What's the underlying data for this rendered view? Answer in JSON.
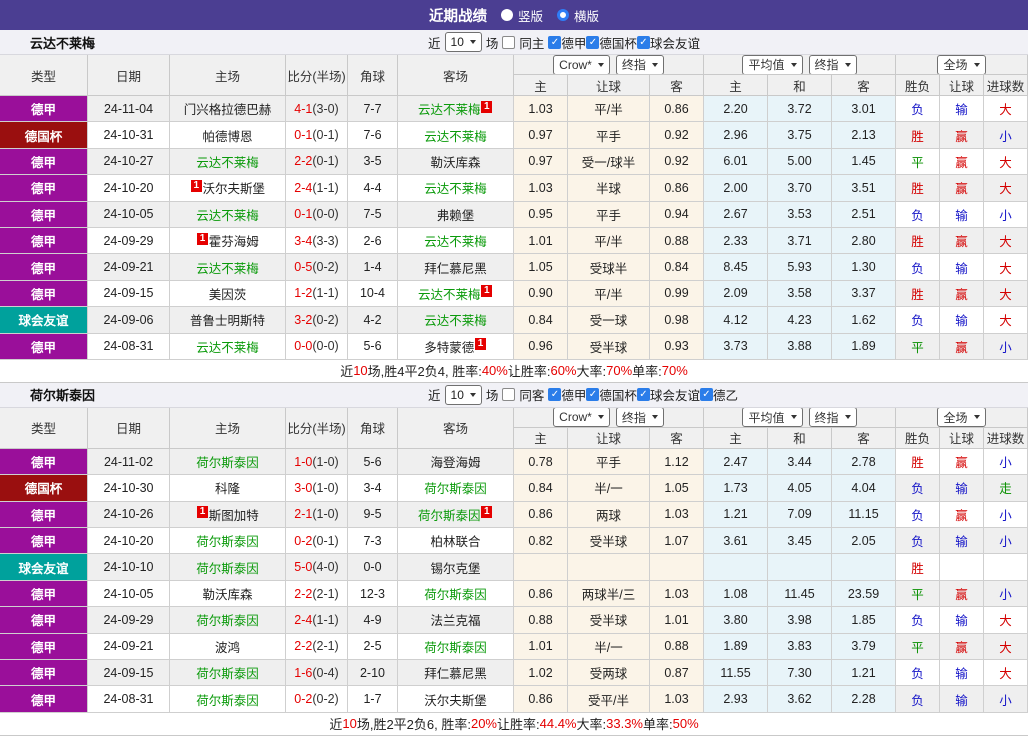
{
  "topbar": {
    "title": "近期战绩",
    "radio_vertical": {
      "label": "竖版",
      "checked": false
    },
    "radio_horizontal": {
      "label": "横版",
      "checked": true
    }
  },
  "colors": {
    "topbar_bg": "#4b3e92",
    "league": {
      "德甲": "#9a0f9a",
      "德国杯": "#9a0f0f",
      "球会友谊": "#00a19c",
      "德乙": "#9a0f9a"
    },
    "result_map": {
      "胜": "#d40000",
      "负": "#1515c8",
      "平": "#089000",
      "赢": "#d40000",
      "输": "#1515c8",
      "走": "#089000",
      "大": "#d40000",
      "小": "#1515c8"
    },
    "score": "#e50000",
    "half": "#333333",
    "team_green": "#0a9a0a",
    "row_stripe": "#efefef",
    "odds_bg": "#fbf4e8",
    "avg_bg": "#e8f4f9"
  },
  "sections": [
    {
      "team": "云达不莱梅",
      "filters": {
        "recent_label": "近",
        "match_count": "10",
        "games_label": "场",
        "same_label": "同主",
        "same_checked": false,
        "leagues": [
          "德甲",
          "德国杯",
          "球会友谊"
        ]
      },
      "selects": {
        "odds_source": "Crow*",
        "odds_time": "终指",
        "avg_label": "平均值",
        "avg_time": "终指",
        "scope": "全场"
      },
      "columns": {
        "left": [
          "类型",
          "日期",
          "主场",
          "比分(半场)",
          "角球",
          "客场"
        ],
        "odds": [
          "主",
          "让球",
          "客"
        ],
        "avg": [
          "主",
          "和",
          "客"
        ],
        "result": [
          "胜负",
          "让球",
          "进球数"
        ]
      },
      "rows": [
        {
          "type": "德甲",
          "date": "24-11-04",
          "home": "门兴格拉德巴赫",
          "hb": "",
          "score": "4-1",
          "half": "(3-0)",
          "corner": "7-7",
          "away": "云达不莱梅",
          "ab": "1",
          "odds": [
            "1.03",
            "平/半",
            "0.86"
          ],
          "avg": [
            "2.20",
            "3.72",
            "3.01"
          ],
          "res": [
            "负",
            "输",
            "大"
          ]
        },
        {
          "type": "德国杯",
          "date": "24-10-31",
          "home": "帕德博恩",
          "hb": "",
          "score": "0-1",
          "half": "(0-1)",
          "corner": "7-6",
          "away": "云达不莱梅",
          "ab": "",
          "odds": [
            "0.97",
            "平手",
            "0.92"
          ],
          "avg": [
            "2.96",
            "3.75",
            "2.13"
          ],
          "res": [
            "胜",
            "赢",
            "小"
          ]
        },
        {
          "type": "德甲",
          "date": "24-10-27",
          "home": "云达不莱梅",
          "hb": "",
          "score": "2-2",
          "half": "(0-1)",
          "corner": "3-5",
          "away": "勒沃库森",
          "ab": "",
          "odds": [
            "0.97",
            "受一/球半",
            "0.92"
          ],
          "avg": [
            "6.01",
            "5.00",
            "1.45"
          ],
          "res": [
            "平",
            "赢",
            "大"
          ]
        },
        {
          "type": "德甲",
          "date": "24-10-20",
          "home": "沃尔夫斯堡",
          "hb": "1",
          "score": "2-4",
          "half": "(1-1)",
          "corner": "4-4",
          "away": "云达不莱梅",
          "ab": "",
          "odds": [
            "1.03",
            "半球",
            "0.86"
          ],
          "avg": [
            "2.00",
            "3.70",
            "3.51"
          ],
          "res": [
            "胜",
            "赢",
            "大"
          ]
        },
        {
          "type": "德甲",
          "date": "24-10-05",
          "home": "云达不莱梅",
          "hb": "",
          "score": "0-1",
          "half": "(0-0)",
          "corner": "7-5",
          "away": "弗赖堡",
          "ab": "",
          "odds": [
            "0.95",
            "平手",
            "0.94"
          ],
          "avg": [
            "2.67",
            "3.53",
            "2.51"
          ],
          "res": [
            "负",
            "输",
            "小"
          ]
        },
        {
          "type": "德甲",
          "date": "24-09-29",
          "home": "霍芬海姆",
          "hb": "1",
          "score": "3-4",
          "half": "(3-3)",
          "corner": "2-6",
          "away": "云达不莱梅",
          "ab": "",
          "odds": [
            "1.01",
            "平/半",
            "0.88"
          ],
          "avg": [
            "2.33",
            "3.71",
            "2.80"
          ],
          "res": [
            "胜",
            "赢",
            "大"
          ]
        },
        {
          "type": "德甲",
          "date": "24-09-21",
          "home": "云达不莱梅",
          "hb": "",
          "score": "0-5",
          "half": "(0-2)",
          "corner": "1-4",
          "away": "拜仁慕尼黑",
          "ab": "",
          "odds": [
            "1.05",
            "受球半",
            "0.84"
          ],
          "avg": [
            "8.45",
            "5.93",
            "1.30"
          ],
          "res": [
            "负",
            "输",
            "大"
          ]
        },
        {
          "type": "德甲",
          "date": "24-09-15",
          "home": "美因茨",
          "hb": "",
          "score": "1-2",
          "half": "(1-1)",
          "corner": "10-4",
          "away": "云达不莱梅",
          "ab": "1",
          "odds": [
            "0.90",
            "平/半",
            "0.99"
          ],
          "avg": [
            "2.09",
            "3.58",
            "3.37"
          ],
          "res": [
            "胜",
            "赢",
            "大"
          ]
        },
        {
          "type": "球会友谊",
          "date": "24-09-06",
          "home": "普鲁士明斯特",
          "hb": "",
          "score": "3-2",
          "half": "(0-2)",
          "corner": "4-2",
          "away": "云达不莱梅",
          "ab": "",
          "odds": [
            "0.84",
            "受一球",
            "0.98"
          ],
          "avg": [
            "4.12",
            "4.23",
            "1.62"
          ],
          "res": [
            "负",
            "输",
            "大"
          ]
        },
        {
          "type": "德甲",
          "date": "24-08-31",
          "home": "云达不莱梅",
          "hb": "",
          "score": "0-0",
          "half": "(0-0)",
          "corner": "5-6",
          "away": "多特蒙德",
          "ab": "1",
          "odds": [
            "0.96",
            "受半球",
            "0.93"
          ],
          "avg": [
            "3.73",
            "3.88",
            "1.89"
          ],
          "res": [
            "平",
            "赢",
            "小"
          ]
        }
      ],
      "summary": [
        {
          "t": "近",
          "c": "k"
        },
        {
          "t": "10",
          "c": "r"
        },
        {
          "t": "场,胜4平2负4, 胜率:",
          "c": "k"
        },
        {
          "t": "40%",
          "c": "r"
        },
        {
          "t": " 让胜率:",
          "c": "k"
        },
        {
          "t": "60%",
          "c": "r"
        },
        {
          "t": " 大率:",
          "c": "k"
        },
        {
          "t": "70%",
          "c": "r"
        },
        {
          "t": " 单率:",
          "c": "k"
        },
        {
          "t": "70%",
          "c": "r"
        }
      ]
    },
    {
      "team": "荷尔斯泰因",
      "filters": {
        "recent_label": "近",
        "match_count": "10",
        "games_label": "场",
        "same_label": "同客",
        "same_checked": false,
        "leagues": [
          "德甲",
          "德国杯",
          "球会友谊",
          "德乙"
        ]
      },
      "selects": {
        "odds_source": "Crow*",
        "odds_time": "终指",
        "avg_label": "平均值",
        "avg_time": "终指",
        "scope": "全场"
      },
      "columns": {
        "left": [
          "类型",
          "日期",
          "主场",
          "比分(半场)",
          "角球",
          "客场"
        ],
        "odds": [
          "主",
          "让球",
          "客"
        ],
        "avg": [
          "主",
          "和",
          "客"
        ],
        "result": [
          "胜负",
          "让球",
          "进球数"
        ]
      },
      "rows": [
        {
          "type": "德甲",
          "date": "24-11-02",
          "home": "荷尔斯泰因",
          "hb": "",
          "score": "1-0",
          "half": "(1-0)",
          "corner": "5-6",
          "away": "海登海姆",
          "ab": "",
          "odds": [
            "0.78",
            "平手",
            "1.12"
          ],
          "avg": [
            "2.47",
            "3.44",
            "2.78"
          ],
          "res": [
            "胜",
            "赢",
            "小"
          ]
        },
        {
          "type": "德国杯",
          "date": "24-10-30",
          "home": "科隆",
          "hb": "",
          "score": "3-0",
          "half": "(1-0)",
          "corner": "3-4",
          "away": "荷尔斯泰因",
          "ab": "",
          "odds": [
            "0.84",
            "半/一",
            "1.05"
          ],
          "avg": [
            "1.73",
            "4.05",
            "4.04"
          ],
          "res": [
            "负",
            "输",
            "走"
          ]
        },
        {
          "type": "德甲",
          "date": "24-10-26",
          "home": "斯图加特",
          "hb": "1",
          "score": "2-1",
          "half": "(1-0)",
          "corner": "9-5",
          "away": "荷尔斯泰因",
          "ab": "1",
          "odds": [
            "0.86",
            "两球",
            "1.03"
          ],
          "avg": [
            "1.21",
            "7.09",
            "11.15"
          ],
          "res": [
            "负",
            "赢",
            "小"
          ]
        },
        {
          "type": "德甲",
          "date": "24-10-20",
          "home": "荷尔斯泰因",
          "hb": "",
          "score": "0-2",
          "half": "(0-1)",
          "corner": "7-3",
          "away": "柏林联合",
          "ab": "",
          "odds": [
            "0.82",
            "受半球",
            "1.07"
          ],
          "avg": [
            "3.61",
            "3.45",
            "2.05"
          ],
          "res": [
            "负",
            "输",
            "小"
          ]
        },
        {
          "type": "球会友谊",
          "date": "24-10-10",
          "home": "荷尔斯泰因",
          "hb": "",
          "score": "5-0",
          "half": "(4-0)",
          "corner": "0-0",
          "away": "锡尔克堡",
          "ab": "",
          "odds": [
            "",
            "",
            ""
          ],
          "avg": [
            "",
            "",
            ""
          ],
          "res": [
            "胜",
            "",
            ""
          ]
        },
        {
          "type": "德甲",
          "date": "24-10-05",
          "home": "勒沃库森",
          "hb": "",
          "score": "2-2",
          "half": "(2-1)",
          "corner": "12-3",
          "away": "荷尔斯泰因",
          "ab": "",
          "odds": [
            "0.86",
            "两球半/三",
            "1.03"
          ],
          "avg": [
            "1.08",
            "11.45",
            "23.59"
          ],
          "res": [
            "平",
            "赢",
            "小"
          ]
        },
        {
          "type": "德甲",
          "date": "24-09-29",
          "home": "荷尔斯泰因",
          "hb": "",
          "score": "2-4",
          "half": "(1-1)",
          "corner": "4-9",
          "away": "法兰克福",
          "ab": "",
          "odds": [
            "0.88",
            "受半球",
            "1.01"
          ],
          "avg": [
            "3.80",
            "3.98",
            "1.85"
          ],
          "res": [
            "负",
            "输",
            "大"
          ]
        },
        {
          "type": "德甲",
          "date": "24-09-21",
          "home": "波鸿",
          "hb": "",
          "score": "2-2",
          "half": "(2-1)",
          "corner": "2-5",
          "away": "荷尔斯泰因",
          "ab": "",
          "odds": [
            "1.01",
            "半/一",
            "0.88"
          ],
          "avg": [
            "1.89",
            "3.83",
            "3.79"
          ],
          "res": [
            "平",
            "赢",
            "大"
          ]
        },
        {
          "type": "德甲",
          "date": "24-09-15",
          "home": "荷尔斯泰因",
          "hb": "",
          "score": "1-6",
          "half": "(0-4)",
          "corner": "2-10",
          "away": "拜仁慕尼黑",
          "ab": "",
          "odds": [
            "1.02",
            "受两球",
            "0.87"
          ],
          "avg": [
            "11.55",
            "7.30",
            "1.21"
          ],
          "res": [
            "负",
            "输",
            "大"
          ]
        },
        {
          "type": "德甲",
          "date": "24-08-31",
          "home": "荷尔斯泰因",
          "hb": "",
          "score": "0-2",
          "half": "(0-2)",
          "corner": "1-7",
          "away": "沃尔夫斯堡",
          "ab": "",
          "odds": [
            "0.86",
            "受平/半",
            "1.03"
          ],
          "avg": [
            "2.93",
            "3.62",
            "2.28"
          ],
          "res": [
            "负",
            "输",
            "小"
          ]
        }
      ],
      "summary": [
        {
          "t": "近",
          "c": "k"
        },
        {
          "t": "10",
          "c": "r"
        },
        {
          "t": "场,胜2平2负6, 胜率:",
          "c": "k"
        },
        {
          "t": "20%",
          "c": "r"
        },
        {
          "t": " 让胜率:",
          "c": "k"
        },
        {
          "t": "44.4%",
          "c": "r"
        },
        {
          "t": " 大率:",
          "c": "k"
        },
        {
          "t": "33.3%",
          "c": "r"
        },
        {
          "t": " 单率:",
          "c": "k"
        },
        {
          "t": "50%",
          "c": "r"
        }
      ]
    }
  ]
}
